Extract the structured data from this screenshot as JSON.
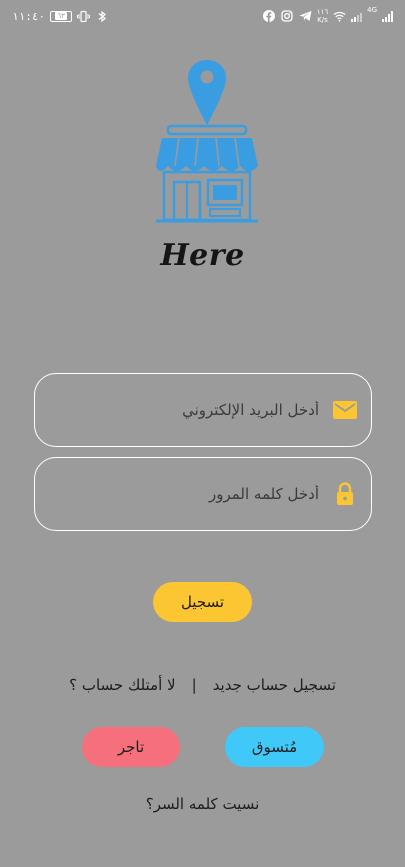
{
  "status_bar": {
    "time": "١١:٤٠",
    "battery": "٦٣",
    "speed_value": "١١٦",
    "speed_unit": "K/s",
    "network": "4G"
  },
  "brand": {
    "name": "Here"
  },
  "login_form": {
    "email_placeholder": "أدخل البريد الإلكتروني",
    "password_placeholder": "أدخل كلمه المرور",
    "login_button": "تسجيل"
  },
  "register": {
    "link": "تسجيل حساب جديد",
    "divider": "|",
    "question": "لا أمتلك حساب ؟"
  },
  "account_types": {
    "shopper": "مُتسوق",
    "merchant": "تاجر"
  },
  "forgot_password": "نسيت كلمه السر؟",
  "colors": {
    "background": "#9b9b9b",
    "logo_blue": "#3a9de2",
    "login_yellow": "#fcc633",
    "merchant_red": "#f66f7d",
    "shopper_blue": "#40c8f8",
    "icon_yellow": "#fcc633"
  }
}
